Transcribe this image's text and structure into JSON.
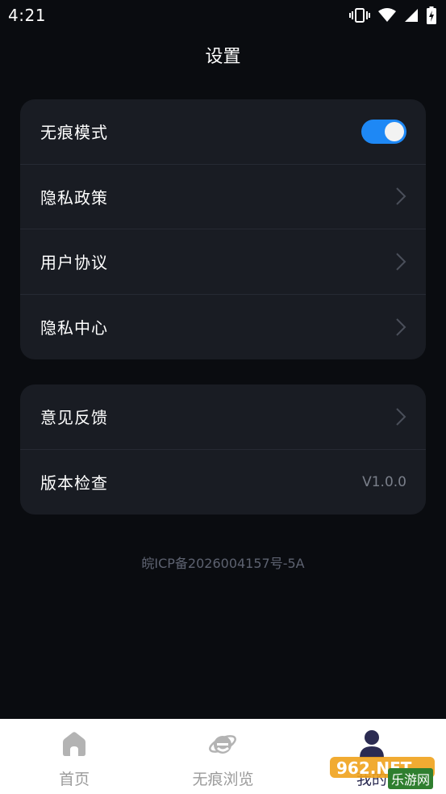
{
  "status_bar": {
    "time": "4:21"
  },
  "header": {
    "title": "设置"
  },
  "settings_group_1": [
    {
      "label": "无痕模式",
      "control": "toggle",
      "toggle_on": true
    },
    {
      "label": "隐私政策",
      "control": "chevron"
    },
    {
      "label": "用户协议",
      "control": "chevron"
    },
    {
      "label": "隐私中心",
      "control": "chevron"
    }
  ],
  "settings_group_2": [
    {
      "label": "意见反馈",
      "control": "chevron"
    },
    {
      "label": "版本检查",
      "control": "value",
      "value": "V1.0.0"
    }
  ],
  "footer": {
    "icp": "皖ICP备2026004157号-5A"
  },
  "tab_bar": {
    "tabs": [
      {
        "label": "首页",
        "icon": "home-icon"
      },
      {
        "label": "无痕浏览",
        "icon": "browser-e-icon"
      },
      {
        "label": "我的",
        "icon": "user-icon",
        "active": true
      }
    ]
  },
  "watermark": {
    "text": "962.NET",
    "sub": "乐游网"
  },
  "colors": {
    "background": "#0a0c10",
    "card": "#191c23",
    "accent_toggle": "#1e88f5",
    "tab_bar": "#ffffff",
    "tab_inactive_text": "#9b9b9b"
  }
}
